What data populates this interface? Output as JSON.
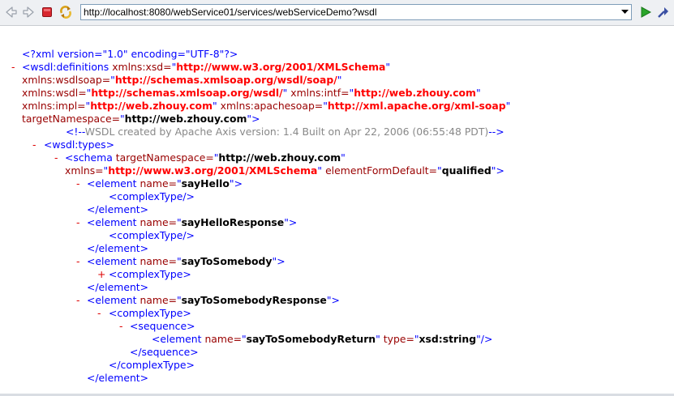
{
  "browser": {
    "url": "http://localhost:8080/webService01/services/webServiceDemo?wsdl",
    "icons": [
      "back-icon",
      "forward-icon",
      "stop-icon",
      "refresh-icon",
      "dropdown-icon",
      "go-icon"
    ],
    "colors": {
      "go": "#2aa52a",
      "stop": "#d8262e"
    }
  },
  "xml": {
    "decl": "<?xml version=\"1.0\" encoding=\"UTF-8\"?>",
    "minus": "-",
    "plus": "+",
    "definitions": {
      "open": "<wsdl:definitions",
      "a_xsd": "xmlns:xsd=",
      "v_xsd": "http://www.w3.org/2001/XMLSchema",
      "a_wsdlsoap": "xmlns:wsdlsoap=",
      "v_wsdlsoap": "http://schemas.xmlsoap.org/wsdl/soap/",
      "a_wsdl": "xmlns:wsdl=",
      "v_wsdl": "http://schemas.xmlsoap.org/wsdl/",
      "a_intf": "xmlns:intf=",
      "v_intf": "http://web.zhouy.com",
      "a_impl": "xmlns:impl=",
      "v_impl": "http://web.zhouy.com",
      "a_apachesoap": "xmlns:apachesoap=",
      "v_apachesoap": "http://xml.apache.org/xml-soap",
      "a_tns": "targetNamespace=",
      "v_tns": "http://web.zhouy.com"
    },
    "comment_open": "<!--",
    "comment": "WSDL created by Apache Axis version: 1.4 Built on Apr 22, 2006 (06:55:48 PDT)",
    "comment_close": "-->",
    "types_open": "<wsdl:types>",
    "schema": {
      "open": "<schema",
      "a_tns": "targetNamespace=",
      "v_tns": "http://web.zhouy.com",
      "a_xmlns": "xmlns=",
      "v_xmlns": "http://www.w3.org/2001/XMLSchema",
      "a_efd": "elementFormDefault=",
      "v_efd": "qualified"
    },
    "element_open": "<element",
    "name_attr": "name=",
    "type_attr": "type=",
    "complexType_selfclose": "<complexType/>",
    "complexType_open": "<complexType>",
    "complexType_close": "</complexType>",
    "element_close": "</element>",
    "sequence_open": "<sequence>",
    "sequence_close": "</sequence>",
    "elements": {
      "e1": "sayHello",
      "e2": "sayHelloResponse",
      "e3": "sayToSomebody",
      "e4": "sayToSomebodyResponse",
      "e5": "sayToSomebodyReturn",
      "e5_type": "xsd:string"
    }
  }
}
